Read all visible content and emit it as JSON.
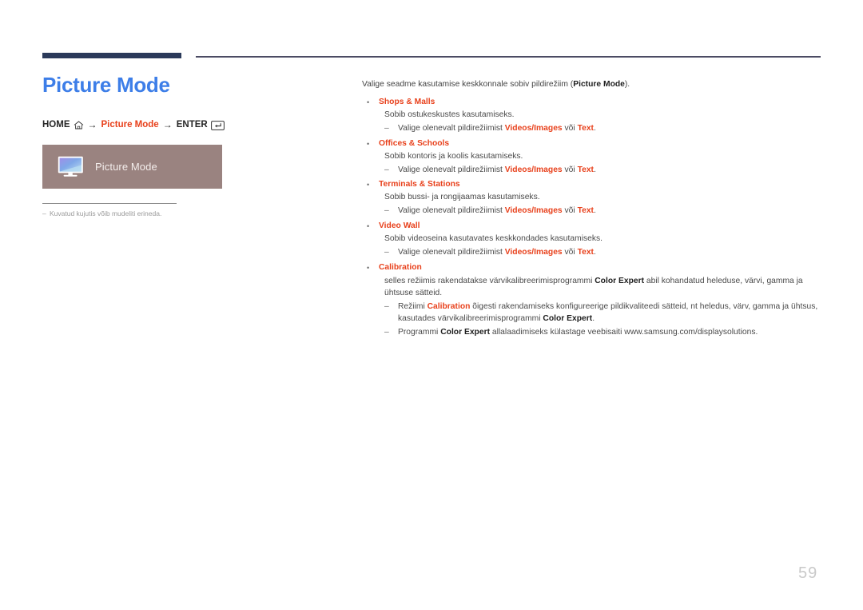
{
  "page": {
    "number": "59",
    "title": "Picture Mode"
  },
  "breadcrumb": {
    "home_label": "HOME",
    "home_icon": "home-icon",
    "arrow": "→",
    "middle_label": "Picture Mode",
    "enter_label": "ENTER",
    "enter_icon": "enter-key-icon"
  },
  "menu_box": {
    "icon": "monitor-icon",
    "label": "Picture Mode"
  },
  "left_note": {
    "dash": "–",
    "text": "Kuvatud kujutis võib mudeliti erineda."
  },
  "content": {
    "intro_a": "Valige seadme kasutamise keskkonnale sobiv pildirežiim (",
    "intro_b": "Picture Mode",
    "intro_c": ").",
    "bullet_char": "•",
    "dash_char": "–",
    "choose_prefix": "Valige olenevalt pildirežiimist ",
    "choose_videos": "Videos/Images",
    "choose_or": " või ",
    "choose_text": "Text",
    "choose_suffix": ".",
    "items": [
      {
        "title": "Shops & Malls",
        "desc": "Sobib ostukeskustes kasutamiseks."
      },
      {
        "title": "Offices & Schools",
        "desc": "Sobib kontoris ja koolis kasutamiseks."
      },
      {
        "title": "Terminals & Stations",
        "desc": "Sobib bussi- ja rongijaamas kasutamiseks."
      },
      {
        "title": "Video Wall",
        "desc": "Sobib videoseina kasutavates keskkondades kasutamiseks."
      }
    ],
    "calibration": {
      "title": "Calibration",
      "desc_a": "selles režiimis rakendatakse värvikalibreerimisprogrammi ",
      "desc_b": "Color Expert",
      "desc_c": " abil kohandatud heleduse, värvi, gamma ja ühtsuse sätteid.",
      "sub1_a": "Režiimi ",
      "sub1_b": "Calibration",
      "sub1_c": " õigesti rakendamiseks konfigureerige pildikvaliteedi sätteid, nt heledus, värv, gamma ja ühtsus, kasutades värvikalibreerimisprogrammi ",
      "sub1_d": "Color Expert",
      "sub1_e": ".",
      "sub2_a": "Programmi ",
      "sub2_b": "Color Expert",
      "sub2_c": " allalaadimiseks külastage veebisaiti www.samsung.com/displaysolutions."
    }
  },
  "colors": {
    "title_blue": "#3d7ee8",
    "accent_red": "#e8411c",
    "rule_navy": "#2b3a5a",
    "menu_box_bg": "#9a8380",
    "page_number_gray": "#c9c9c9"
  }
}
